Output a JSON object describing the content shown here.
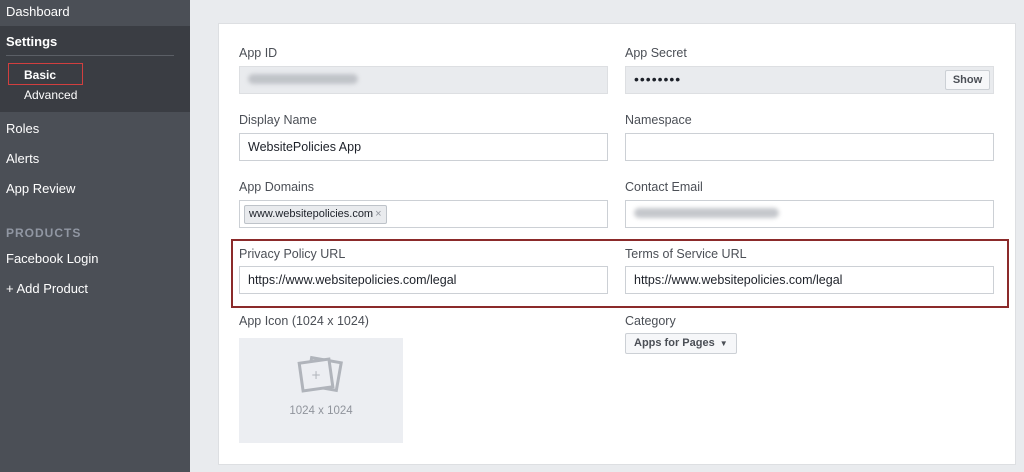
{
  "sidebar": {
    "dashboard": "Dashboard",
    "settings": "Settings",
    "basic": "Basic",
    "advanced": "Advanced",
    "roles": "Roles",
    "alerts": "Alerts",
    "app_review": "App Review",
    "products_header": "PRODUCTS",
    "facebook_login": "Facebook Login",
    "add_product": "+ Add Product"
  },
  "form": {
    "app_id_label": "App ID",
    "app_secret_label": "App Secret",
    "app_secret_value": "••••••••",
    "show_button": "Show",
    "display_name_label": "Display Name",
    "display_name_value": "WebsitePolicies App",
    "namespace_label": "Namespace",
    "namespace_value": "",
    "app_domains_label": "App Domains",
    "app_domain_tag": "www.websitepolicies.com",
    "contact_email_label": "Contact Email",
    "privacy_label": "Privacy Policy URL",
    "privacy_value": "https://www.websitepolicies.com/legal",
    "tos_label": "Terms of Service URL",
    "tos_value": "https://www.websitepolicies.com/legal",
    "app_icon_label": "App Icon (1024 x 1024)",
    "app_icon_size": "1024 x 1024",
    "category_label": "Category",
    "category_value": "Apps for Pages"
  },
  "colors": {
    "sidebar_bg": "#4b4f56",
    "highlight_border": "#8b2a2a",
    "basic_border": "#d23f3f"
  }
}
